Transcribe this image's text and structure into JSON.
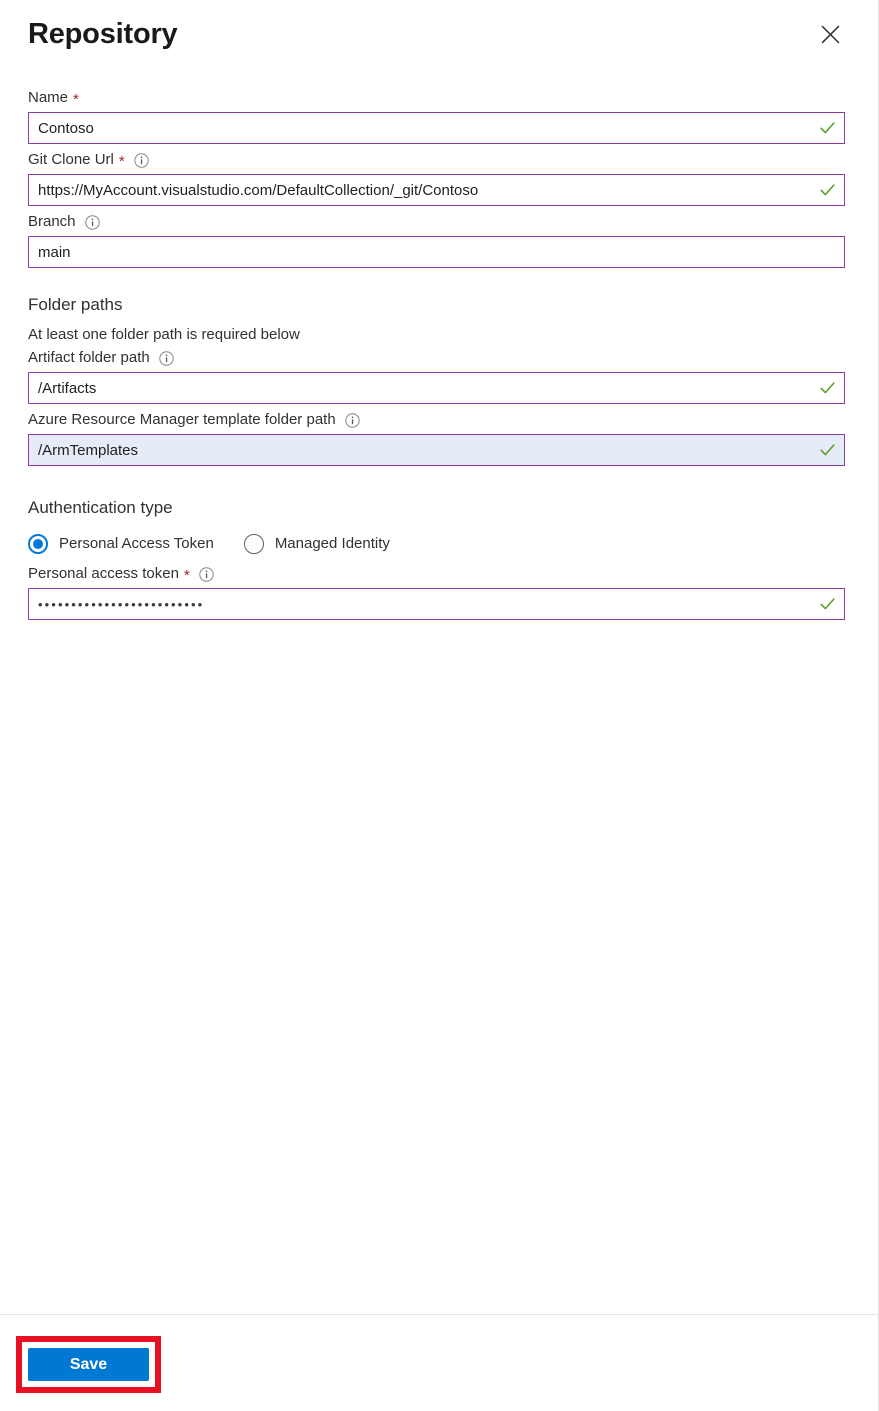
{
  "blade": {
    "title": "Repository",
    "close_icon": "close-icon",
    "close_label": "Close"
  },
  "fields": {
    "name": {
      "label": "Name",
      "required_marker": "*",
      "value": "Contoso",
      "placeholder": "",
      "valid": true,
      "has_info": false
    },
    "git_clone_url": {
      "label": "Git Clone Url",
      "required_marker": "*",
      "value": "https://MyAccount.visualstudio.com/DefaultCollection/_git/Contoso",
      "placeholder": "",
      "valid": true,
      "has_info": true
    },
    "branch": {
      "label": "Branch",
      "required_marker": "",
      "value": "main",
      "placeholder": "",
      "valid": false,
      "has_info": true
    },
    "artifact_folder_path": {
      "label": "Artifact folder path",
      "required_marker": "",
      "value": "/Artifacts",
      "placeholder": "",
      "valid": true,
      "has_info": true
    },
    "arm_template_folder_path": {
      "label": "Azure Resource Manager template folder path",
      "required_marker": "",
      "value": "/ArmTemplates",
      "placeholder": "",
      "valid": true,
      "has_info": true,
      "focused": true
    },
    "personal_access_token": {
      "label": "Personal access token",
      "required_marker": "*",
      "value": "•••••••••••••••••••••••••",
      "placeholder": "",
      "valid": true,
      "has_info": true
    }
  },
  "folder_paths_section": {
    "heading": "Folder paths",
    "helper_text": "At least one folder path is required below"
  },
  "authentication_section": {
    "heading": "Authentication type",
    "options": [
      {
        "label": "Personal Access Token",
        "selected": true
      },
      {
        "label": "Managed Identity",
        "selected": false
      }
    ]
  },
  "footer": {
    "save_label": "Save",
    "highlight_color": "#e81123"
  },
  "colors": {
    "accent_blue": "#0078d4",
    "input_border_purple": "#8a3ba5",
    "valid_check_green": "#5a9e28",
    "required_red": "#a4262c",
    "focused_field_bg": "#e5ebf7",
    "annotation_red": "#e81123"
  },
  "icons": {
    "info": "info-icon",
    "check": "check-icon"
  }
}
